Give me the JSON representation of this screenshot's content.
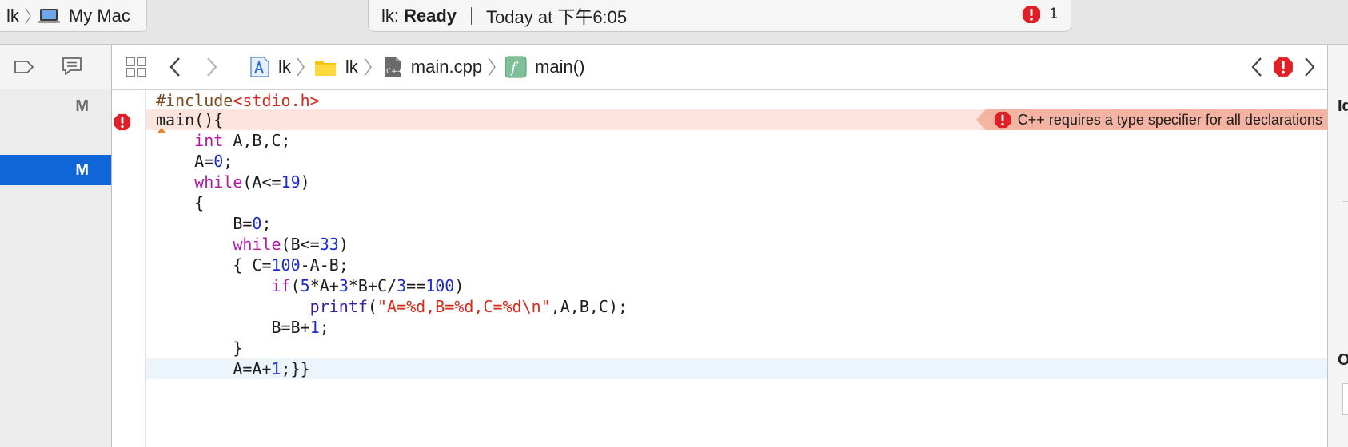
{
  "toolbar": {
    "scheme": {
      "project": "lk",
      "destination": "My Mac"
    },
    "activity": {
      "project": "lk:",
      "status": "Ready",
      "time": "Today at 下午6:05",
      "error_count": "1"
    }
  },
  "navigator": {
    "rows": [
      {
        "label": "M",
        "selected": false
      },
      {
        "label": "M",
        "selected": true
      }
    ]
  },
  "jumpbar": {
    "crumbs": [
      {
        "label": "lk",
        "icon": "xcode-project-icon"
      },
      {
        "label": "lk",
        "icon": "folder-icon"
      },
      {
        "label": "main.cpp",
        "icon": "cpp-file-icon"
      },
      {
        "label": "main()",
        "icon": "function-icon"
      }
    ]
  },
  "editor": {
    "error_message": "C++ requires a type specifier for all declarations",
    "lines": [
      "#include<stdio.h>",
      "main(){",
      "    int A,B,C;",
      "    A=0;",
      "    while(A<=19)",
      "    {",
      "        B=0;",
      "        while(B<=33)",
      "        { C=100-A-B;",
      "            if(5*A+3*B+C/3==100)",
      "                printf(\"A=%d,B=%d,C=%d\\n\",A,B,C);",
      "            B=B+1;",
      "        }",
      "        A=A+1;}}"
    ]
  },
  "inspector": {
    "header_a": "Id",
    "header_b": "O"
  },
  "colors": {
    "accent": "#0f66d8",
    "error_red": "#e21f26",
    "error_line_bg": "#fde4dc",
    "issue_bg": "#f4b3a3",
    "keyword": "#b21aa3",
    "number": "#1c2bd0",
    "string": "#d42a1a"
  }
}
